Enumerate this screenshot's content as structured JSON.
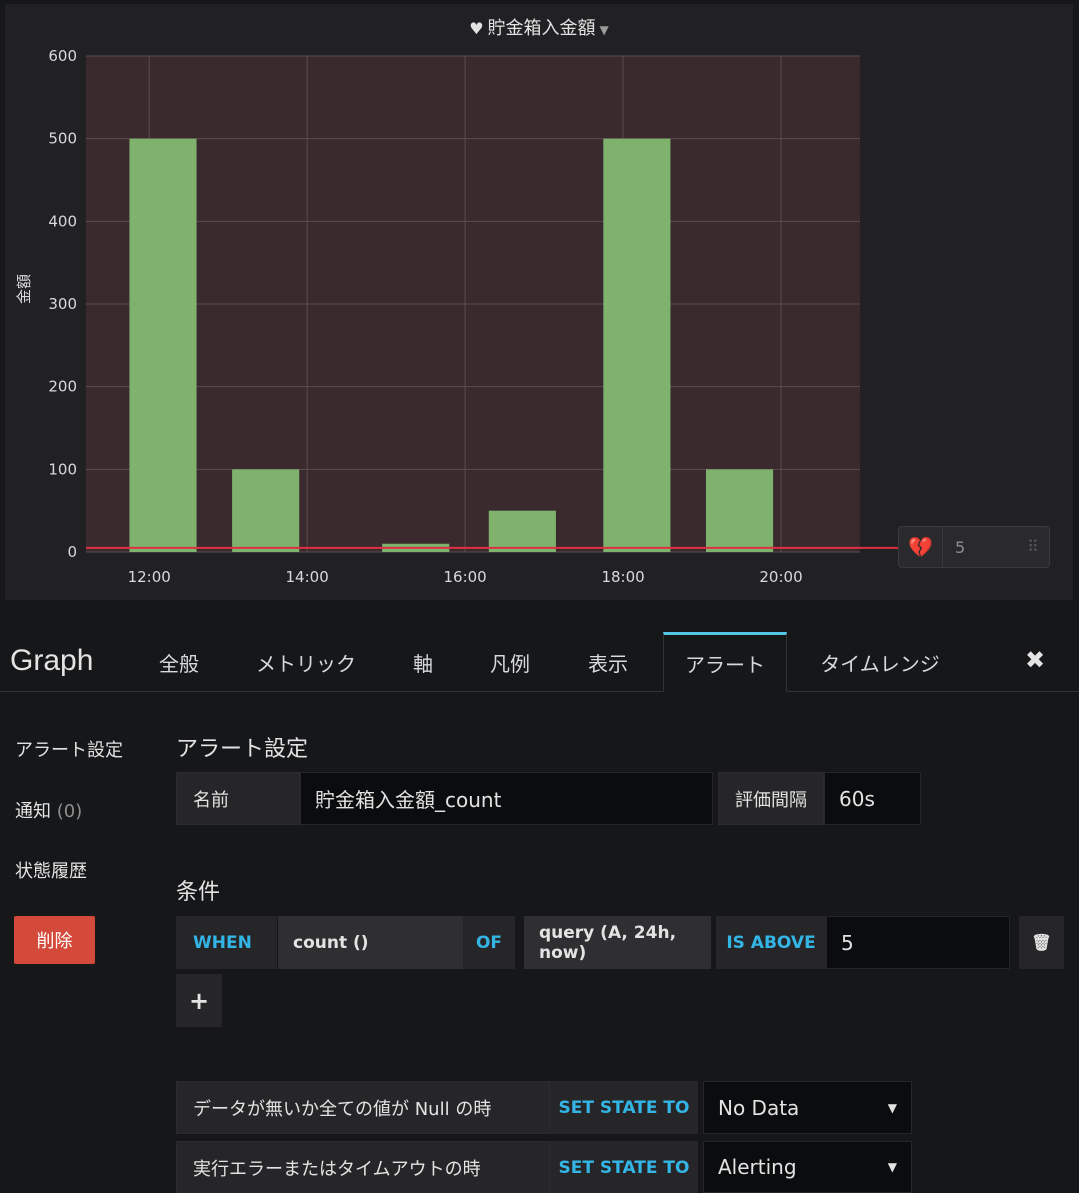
{
  "panel": {
    "title": "貯金箱入金額",
    "threshold_value": "5"
  },
  "chart_data": {
    "type": "bar",
    "title": "貯金箱入金額",
    "xlabel": "",
    "ylabel": "金額",
    "x_tick_labels": [
      "12:00",
      "14:00",
      "16:00",
      "18:00",
      "20:00"
    ],
    "y_tick_labels": [
      "0",
      "100",
      "200",
      "300",
      "400",
      "500",
      "600"
    ],
    "ylim": [
      0,
      600
    ],
    "x_domain_hours": [
      11.2,
      21.0
    ],
    "bars": [
      {
        "start": 11.75,
        "end": 12.6,
        "value": 500
      },
      {
        "start": 13.05,
        "end": 13.9,
        "value": 100
      },
      {
        "start": 14.95,
        "end": 15.8,
        "value": 10
      },
      {
        "start": 16.3,
        "end": 17.15,
        "value": 50
      },
      {
        "start": 17.75,
        "end": 18.6,
        "value": 500
      },
      {
        "start": 19.05,
        "end": 19.9,
        "value": 100
      }
    ],
    "threshold": 5,
    "grid": true,
    "colors": {
      "bar": "#7eb26d",
      "threshold": "#e02f44",
      "plot_bg": "#3a2a2e"
    }
  },
  "editor": {
    "title": "Graph",
    "tabs": [
      "全般",
      "メトリック",
      "軸",
      "凡例",
      "表示",
      "アラート",
      "タイムレンジ"
    ],
    "active_tab": "アラート"
  },
  "sidebar": {
    "alert_settings": "アラート設定",
    "notifications": "通知",
    "notifications_count": "(0)",
    "state_history": "状態履歴",
    "delete": "削除"
  },
  "alert": {
    "section_title": "アラート設定",
    "name_label": "名前",
    "name_value": "貯金箱入金額_count",
    "interval_label": "評価間隔",
    "interval_value": "60s"
  },
  "conditions": {
    "section_title": "条件",
    "when": "WHEN",
    "reducer": "count ()",
    "of": "OF",
    "query": "query (A, 24h, now)",
    "evaluator": "IS ABOVE",
    "threshold": "5"
  },
  "no_data": {
    "label": "データが無いか全ての値が Null の時",
    "set_state": "SET STATE TO",
    "value": "No Data"
  },
  "exec_error": {
    "label": "実行エラーまたはタイムアウトの時",
    "set_state": "SET STATE TO",
    "value": "Alerting"
  }
}
